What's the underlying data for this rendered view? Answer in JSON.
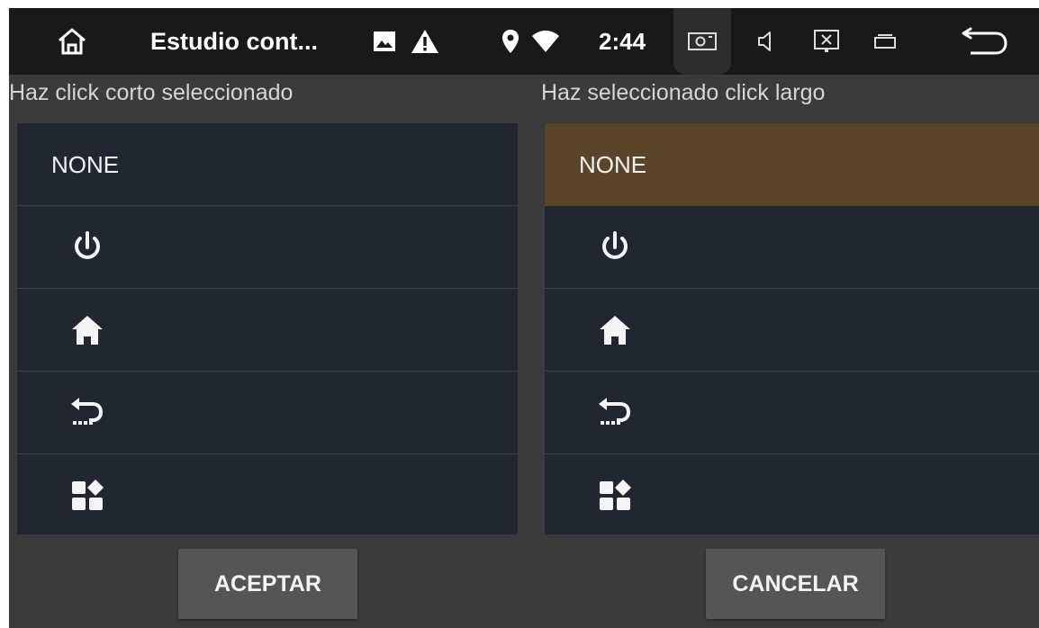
{
  "status_bar": {
    "title": "Estudio cont...",
    "time": "2:44",
    "icons": [
      "home-outline-icon",
      "image-icon",
      "warning-icon",
      "location-icon",
      "wifi-icon",
      "screenshot-icon",
      "volume-icon",
      "close-window-icon",
      "recents-icon",
      "back-icon"
    ]
  },
  "left_panel": {
    "heading": "Haz click corto seleccionado",
    "items": [
      {
        "label": "NONE",
        "icon": null,
        "selected": false
      },
      {
        "label": "",
        "icon": "power-icon",
        "selected": false
      },
      {
        "label": "",
        "icon": "home-icon",
        "selected": false
      },
      {
        "label": "",
        "icon": "back-icon",
        "selected": false
      },
      {
        "label": "",
        "icon": "apps-icon",
        "selected": false
      }
    ]
  },
  "right_panel": {
    "heading": "Haz seleccionado click largo",
    "items": [
      {
        "label": "NONE",
        "icon": null,
        "selected": true
      },
      {
        "label": "",
        "icon": "power-icon",
        "selected": false
      },
      {
        "label": "",
        "icon": "home-icon",
        "selected": false
      },
      {
        "label": "",
        "icon": "back-icon",
        "selected": false
      },
      {
        "label": "",
        "icon": "apps-icon",
        "selected": false
      }
    ]
  },
  "buttons": {
    "accept_label": "ACEPTAR",
    "cancel_label": "CANCELAR"
  },
  "colors": {
    "statusbar": "#191919",
    "background": "#3b3b3b",
    "list_background": "#222630",
    "selected_row": "#5a452b",
    "button": "#555555"
  }
}
